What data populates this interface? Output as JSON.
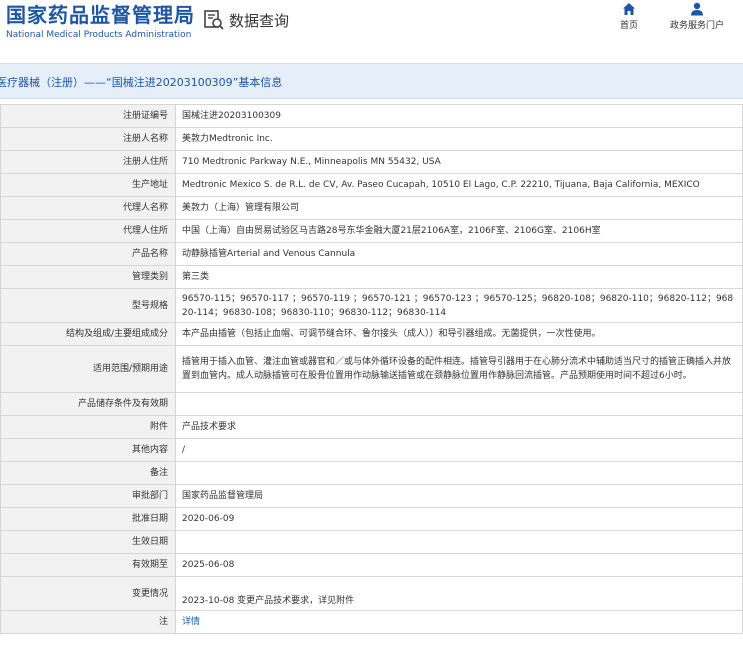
{
  "header": {
    "logo_cn": "国家药品监督管理局",
    "logo_en": "National Medical Products Administration",
    "query_label": "数据查询",
    "nav_home": "首页",
    "nav_service": "政务服务门户"
  },
  "page_title": "医疗器械（注册）——“国械注进20203100309”基本信息",
  "rows": [
    {
      "label": "注册证编号",
      "value": "国械注进20203100309"
    },
    {
      "label": "注册人名称",
      "value": "美敦力Medtronic Inc."
    },
    {
      "label": "注册人住所",
      "value": "710 Medtronic Parkway N.E., Minneapolis MN 55432, USA"
    },
    {
      "label": "生产地址",
      "value": "Medtronic Mexico S. de R.L. de CV, Av. Paseo Cucapah, 10510 El Lago, C.P. 22210, Tijuana, Baja California, MEXICO"
    },
    {
      "label": "代理人名称",
      "value": "美敦力（上海）管理有限公司"
    },
    {
      "label": "代理人住所",
      "value": "中国（上海）自由贸易试验区马吉路28号东华金融大厦21层2106A室，2106F室、2106G室、2106H室"
    },
    {
      "label": "产品名称",
      "value": "动静脉插管Arterial and Venous Cannula"
    },
    {
      "label": "管理类别",
      "value": "第三类"
    },
    {
      "label": "型号规格",
      "value": "96570-115；96570-117 ；96570-119 ；96570-121 ；96570-123 ；96570-125；96820-108；96820-110；96820-112；96820-114；96830-108；96830-110；96830-112；96830-114"
    },
    {
      "label": "结构及组成/主要组成成分",
      "value": "本产品由插管（包括止血帽、可调节缝合环、鲁尔接头（成人））和导引器组成。无菌提供，一次性使用。"
    },
    {
      "label": "适用范围/预期用途",
      "value": "插管用于插入血管、灌注血管或器官和／或与体外循环设备的配件相连。插管导引器用于在心肺分流术中辅助适当尺寸的插管正确插入并放置到血管内。成人动脉插管可在股骨位置用作动脉输送插管或在颈静脉位置用作静脉回流插管。产品预期使用时间不超过6小时。"
    },
    {
      "label": "产品储存条件及有效期",
      "value": ""
    },
    {
      "label": "附件",
      "value": "产品技术要求"
    },
    {
      "label": "其他内容",
      "value": "/"
    },
    {
      "label": "备注",
      "value": ""
    },
    {
      "label": "审批部门",
      "value": "国家药品监督管理局"
    },
    {
      "label": "批准日期",
      "value": "2020-06-09"
    },
    {
      "label": "生效日期",
      "value": ""
    },
    {
      "label": "有效期至",
      "value": "2025-06-08"
    },
    {
      "label": "变更情况",
      "value": "2023-10-08 变更产品技术要求，详见附件"
    },
    {
      "label": "注",
      "value": "详情"
    }
  ]
}
